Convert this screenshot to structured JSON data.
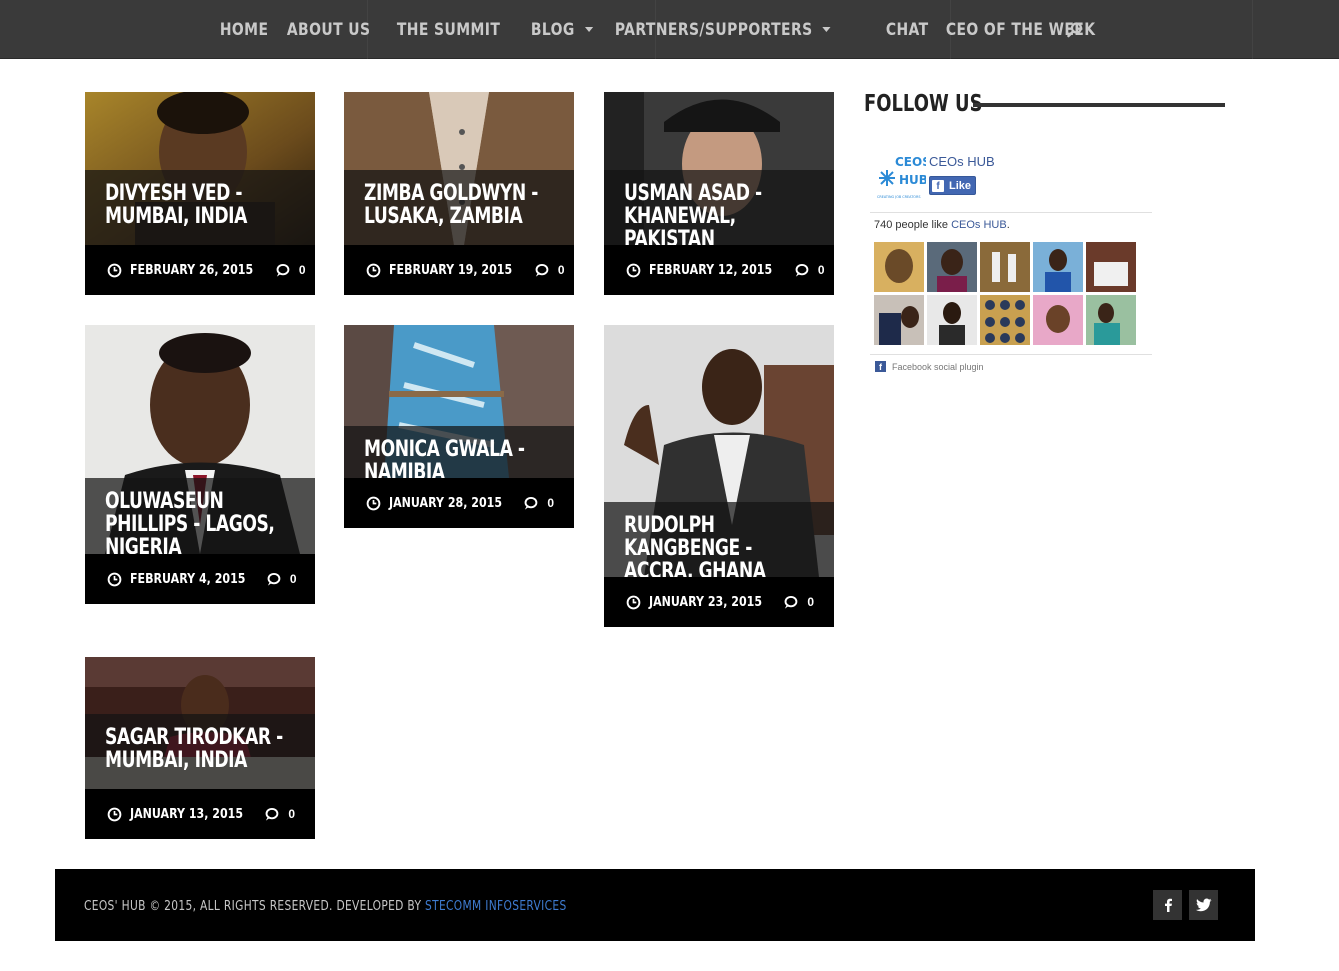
{
  "nav": {
    "items": [
      {
        "label": "HOME",
        "dropdown": false
      },
      {
        "label": "ABOUT US",
        "dropdown": false
      },
      {
        "label": "THE SUMMIT",
        "dropdown": false
      },
      {
        "label": "BLOG",
        "dropdown": true
      },
      {
        "label": "PARTNERS/SUPPORTERS",
        "dropdown": true
      },
      {
        "label": "CHAT",
        "dropdown": false
      },
      {
        "label": "CEO OF THE WEEK",
        "dropdown": false
      }
    ],
    "search_icon": "search-icon",
    "background": "#3a3a3a"
  },
  "posts": [
    {
      "title": "DIVYESH VED - MUMBAI, INDIA",
      "date": "FEBRUARY 26, 2015",
      "comments": "0"
    },
    {
      "title": "ZIMBA GOLDWYN - LUSAKA, ZAMBIA",
      "date": "FEBRUARY 19, 2015",
      "comments": "0"
    },
    {
      "title": "USMAN ASAD - KHANEWAL, PAKISTAN",
      "date": "FEBRUARY 12, 2015",
      "comments": "0"
    },
    {
      "title": "OLUWASEUN PHILLIPS - LAGOS, NIGERIA",
      "date": "FEBRUARY 4, 2015",
      "comments": "0"
    },
    {
      "title": "MONICA GWALA - NAMIBIA",
      "date": "JANUARY 28, 2015",
      "comments": "0"
    },
    {
      "title": "RUDOLPH KANGBENGE - ACCRA, GHANA",
      "date": "JANUARY 23, 2015",
      "comments": "0"
    },
    {
      "title": "SAGAR TIRODKAR - MUMBAI, INDIA",
      "date": "JANUARY 13, 2015",
      "comments": "0"
    }
  ],
  "sidebar": {
    "follow_title": "FOLLOW US",
    "facebook": {
      "page_name": "CEOs HUB",
      "like_label": "Like",
      "count_prefix": "740 people like ",
      "count_link": "CEOs HUB",
      "count_suffix": ".",
      "plugin_label": "Facebook social plugin",
      "logo_text_1": "CEOS",
      "logo_text_2": "HUB",
      "logo_tagline": "CREATING JOB CREATORS"
    }
  },
  "footer": {
    "copyright": "CEOS' HUB © 2015, ALL RIGHTS RESERVED. DEVELOPED BY ",
    "developer": "STECOMM INFOSERVICES",
    "social": [
      "facebook-icon",
      "twitter-icon"
    ]
  },
  "colors": {
    "accent_link": "#3e7bd0",
    "facebook_blue": "#3b5998"
  }
}
